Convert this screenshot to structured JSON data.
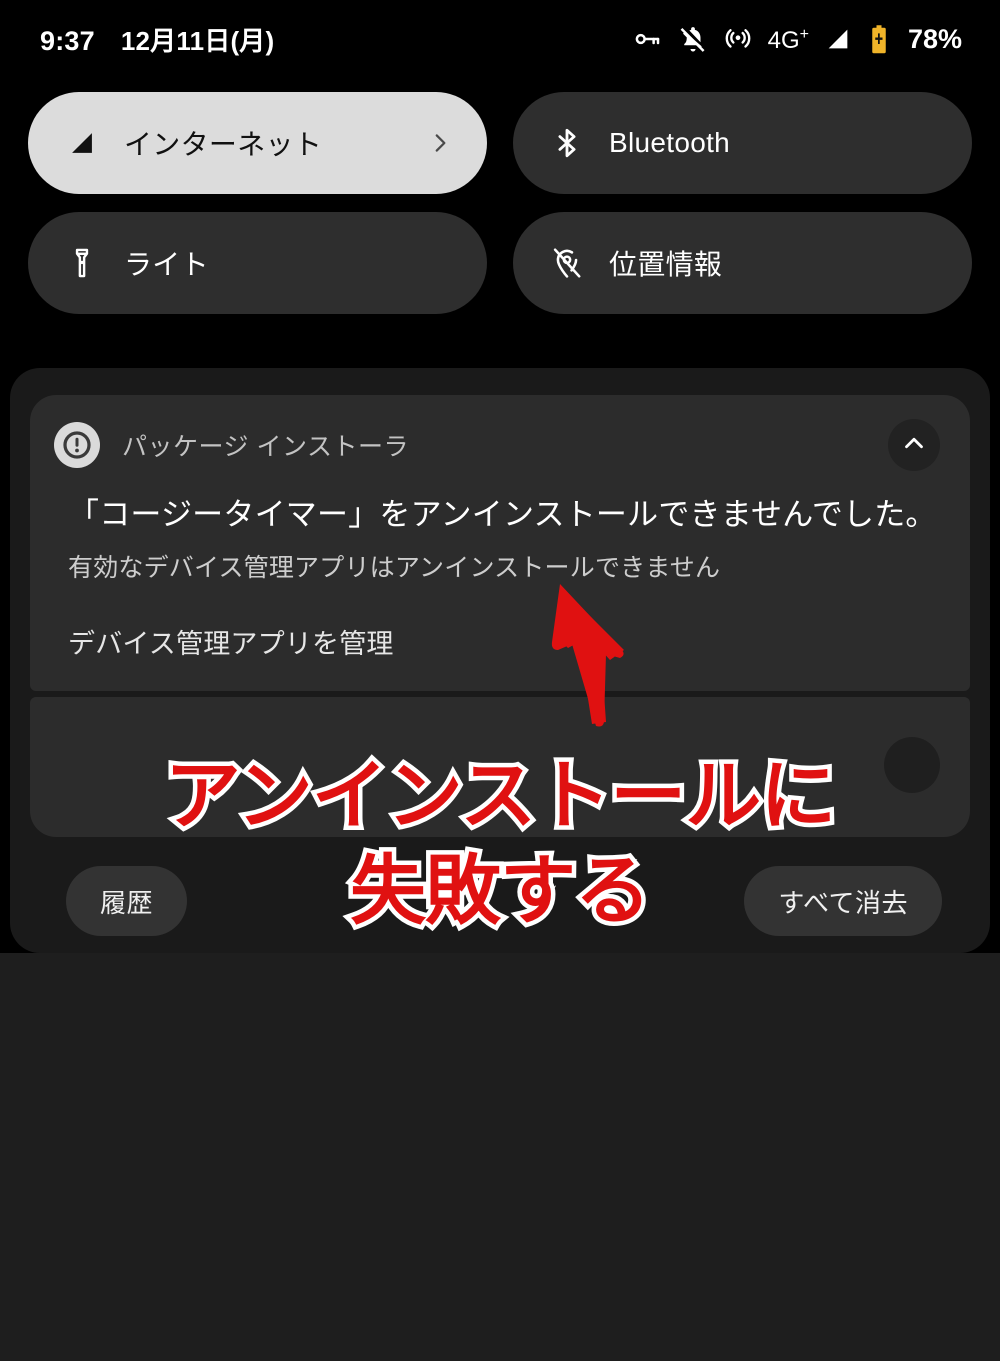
{
  "status_bar": {
    "time": "9:37",
    "date": "12月11日(月)",
    "icons": [
      "vpn-key-icon",
      "bell-muted-icon",
      "hotspot-icon",
      "signal-icon",
      "battery-charging-icon"
    ],
    "network_type": "4G",
    "network_type_sup": "+",
    "battery_percent": "78%",
    "battery_color": "#f0b429"
  },
  "quick_settings": {
    "tiles": [
      {
        "label": "インターネット",
        "icon": "signal-triangle-icon",
        "active": true,
        "has_chevron": true,
        "bg": "#dcdcdc",
        "fg": "#111111"
      },
      {
        "label": "Bluetooth",
        "icon": "bluetooth-icon",
        "active": false,
        "has_chevron": false,
        "bg": "#2e2e2e",
        "fg": "#ffffff"
      },
      {
        "label": "ライト",
        "icon": "flashlight-icon",
        "active": false,
        "has_chevron": false,
        "bg": "#2e2e2e",
        "fg": "#ffffff"
      },
      {
        "label": "位置情報",
        "icon": "location-off-icon",
        "active": false,
        "has_chevron": false,
        "bg": "#2e2e2e",
        "fg": "#ffffff"
      }
    ]
  },
  "notifications": {
    "card1": {
      "app_name": "パッケージ インストーラ",
      "app_icon": "error-circle-icon",
      "expand_icon": "chevron-up-icon",
      "title": "「コージータイマー」をアンインストールできませんでした。",
      "body": "有効なデバイス管理アプリはアンインストールできません",
      "action_label": "デバイス管理アプリを管理"
    },
    "card2": {
      "expand_icon": "chevron-icon"
    }
  },
  "shade_footer": {
    "history_label": "履歴",
    "clear_all_label": "すべて消去"
  },
  "annotation": {
    "line1": "アンインストールに",
    "line2": "失敗する",
    "color": "#e01111",
    "outline_color": "#ffffff",
    "arrow": "red-arrow-up-left"
  }
}
